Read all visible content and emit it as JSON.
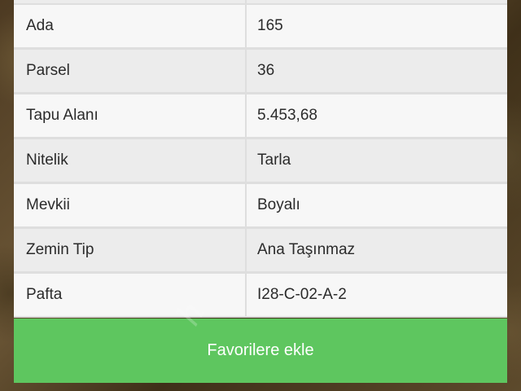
{
  "rows": [
    {
      "label": "Ada",
      "value": "165"
    },
    {
      "label": "Parsel",
      "value": "36"
    },
    {
      "label": "Tapu Alanı",
      "value": "5.453,68"
    },
    {
      "label": "Nitelik",
      "value": "Tarla"
    },
    {
      "label": "Mevkii",
      "value": "Boyalı"
    },
    {
      "label": "Zemin Tip",
      "value": "Ana Taşınmaz"
    },
    {
      "label": "Pafta",
      "value": "I28-C-02-A-2"
    }
  ],
  "favorite_button": {
    "label": "Favorilere ekle"
  },
  "colors": {
    "button_green": "#5ec65f",
    "row_light": "#f7f7f7",
    "row_dark": "#ececec"
  }
}
